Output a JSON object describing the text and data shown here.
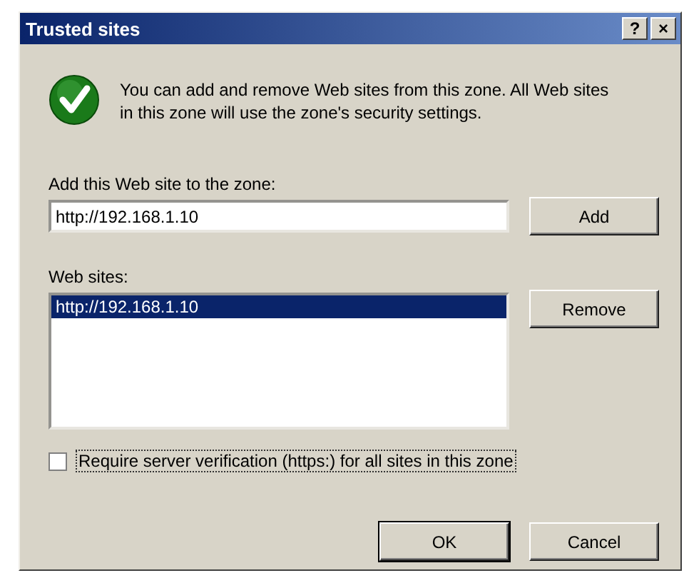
{
  "window": {
    "title": "Trusted sites",
    "help_button": "?",
    "close_button": "×"
  },
  "message": "You can add and remove Web sites from this zone. All Web sites in this zone will use the zone's security settings.",
  "add_field": {
    "label": "Add this Web site to the zone:",
    "value": "http://192.168.1.10"
  },
  "add_button": "Add",
  "sites": {
    "label": "Web sites:",
    "items": [
      {
        "text": "http://192.168.1.10",
        "selected": true
      }
    ]
  },
  "remove_button": "Remove",
  "require_verification": {
    "label": "Require server verification (https:) for all sites in this zone",
    "checked": false
  },
  "buttons": [
    "OK",
    "Cancel"
  ]
}
